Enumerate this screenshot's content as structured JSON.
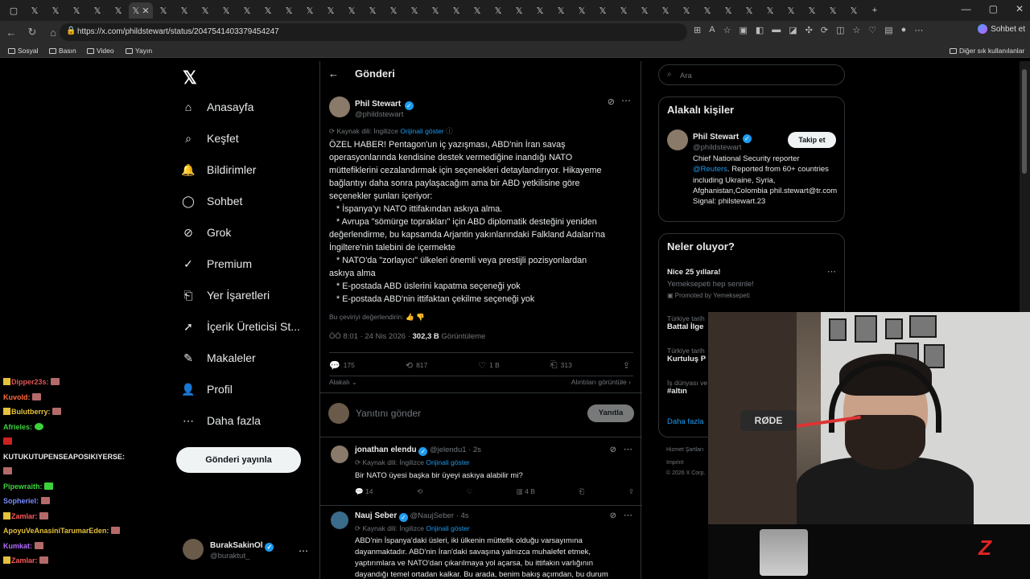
{
  "browser": {
    "url": "https://x.com/phildstewart/status/2047541403379454247",
    "copilot_label": "Sohbet et",
    "bookmarks": [
      "Sosyal",
      "Basın",
      "Video",
      "Yayın"
    ],
    "other_bookmarks": "Diğer sık kullanılanlar"
  },
  "nav": {
    "items": [
      "Anasayfa",
      "Keşfet",
      "Bildirimler",
      "Sohbet",
      "Grok",
      "Premium",
      "Yer İşaretleri",
      "İçerik Üreticisi St...",
      "Makaleler",
      "Profil",
      "Daha fazla"
    ],
    "post_button": "Gönderi yayınla",
    "user_name": "BurakSakinOl",
    "user_handle": "@buraktut_"
  },
  "chat": [
    {
      "user": "Dipper23s:",
      "color": "#e05555"
    },
    {
      "user": "Kuvold:",
      "color": "#ff6b3d"
    },
    {
      "user": "Bulutberry:",
      "color": "#e5c13c"
    },
    {
      "user": "Afrieles:",
      "color": "#3cd23c"
    },
    {
      "user": "KUTUKUTUPENSEAPOSIKIYERSE:",
      "color": "#e7e9ea"
    },
    {
      "user": "Pipewraith:",
      "color": "#3cd23c"
    },
    {
      "user": "Sopheriel:",
      "color": "#7a8cff"
    },
    {
      "user": "Zamlar:",
      "color": "#ff5a5a"
    },
    {
      "user": "ApoyuVeAnasiniTarumarEden:",
      "color": "#e5c13c"
    },
    {
      "user": "Kumkat:",
      "color": "#b46cff"
    },
    {
      "user": "Zamlar:",
      "color": "#ff5a5a"
    }
  ],
  "main": {
    "header": "Gönderi",
    "tweet": {
      "name": "Phil Stewart",
      "handle": "@phildstewart",
      "source_label": "Kaynak dili: İngilizce",
      "show_original": "Orijinali göster",
      "body": "ÖZEL HABER! Pentagon'un iç yazışması, ABD'nin İran savaş\noperasyonlarında kendisine destek vermediğine inandığı NATO\nmüttefiklerini cezalandırmak için seçenekleri detaylandırıyor. Hikayeme\nbağlantıyı daha sonra paylaşacağım ama bir ABD yetkilisine göre\nseçenekler şunları içeriyor:\n   * İspanya'yı NATO ittifakından askıya alma.\n   * Avrupa \"sömürge toprakları\" için ABD diplomatik desteğini yeniden\ndeğerlendirme, bu kapsamda Arjantin yakınlarındaki Falkland Adaları'na\nİngiltere'nin talebini de içermekte\n   * NATO'da \"zorlayıcı\" ülkeleri önemli veya prestijli pozisyonlardan\naskıya alma\n   * E-postada ABD üslerini kapatma seçeneği yok\n   * E-postada ABD'nin ittifaktan çekilme seçeneği yok",
      "rate_translation": "Bu çeviriyi değerlendirin:",
      "time": "ÖÖ 8:01 · 24 Nis 2026 · ",
      "views": "302,3 B",
      "views_label": " Görüntüleme",
      "replies": "175",
      "reposts": "817",
      "likes": "1 B",
      "bookmarks": "313",
      "related": "Alakalı",
      "quotes": "Alıntıları görüntüle"
    },
    "reply_placeholder": "Yanıtını gönder",
    "reply_button": "Yanıtla",
    "replies": [
      {
        "name": "jonathan elendu",
        "handle": "@jelendu1 · 2s",
        "source_label": "Kaynak dili: İngilizce",
        "show_original": "Orijinali göster",
        "text": "Bir NATO üyesi başka bir üyeyi askıya alabilir mi?",
        "replies": "14",
        "views": "4 B"
      },
      {
        "name": "Nauj Seber",
        "handle": "@NaujSeber · 4s",
        "source_label": "Kaynak dili: İngilizce",
        "show_original": "Orijinali göster",
        "text": "ABD'nin İspanya'daki üsleri, iki ülkenin müttefik olduğu varsayımına\ndayanmaktadır. ABD'nin İran'daki savaşına yalnızca muhalefet etmek,\nyaptırımlara ve NATO'dan çıkarılmaya yol açarsa, bu ittifakın varlığının\ndayandığı temel ortadan kalkar. Bu arada, benim bakış açımdan, bu durum"
      }
    ]
  },
  "right": {
    "search_placeholder": "Ara",
    "related_title": "Alakalı kişiler",
    "person": {
      "name": "Phil Stewart",
      "handle": "@phildstewart",
      "follow": "Takip et",
      "bio_pre": "Chief National Security reporter ",
      "bio_link": "@Reuters",
      "bio_post": ". Reported from 60+ countries including Ukraine, Syria, Afghanistan,Colombia phil.stewart@tr.com Signal: philstewart.23"
    },
    "trends_title": "Neler oluyor?",
    "promo_title": "Nice 25 yıllara!",
    "promo_sub": "Yemeksepeti hep seninle!",
    "promo_by": "Promoted by Yemeksepeti",
    "trends": [
      {
        "ctx": "Türkiye tarih",
        "name": "Battal İlge"
      },
      {
        "ctx": "Türkiye tarih",
        "name": "Kurtuluş P"
      },
      {
        "ctx": "İş dünyası ve",
        "name": "#altın"
      }
    ],
    "show_more": "Daha fazla",
    "footer": [
      "Hizmet Şartları",
      "Imprint",
      "© 2026 X Corp."
    ]
  },
  "webcam": {
    "mic_brand": "RØDE"
  }
}
